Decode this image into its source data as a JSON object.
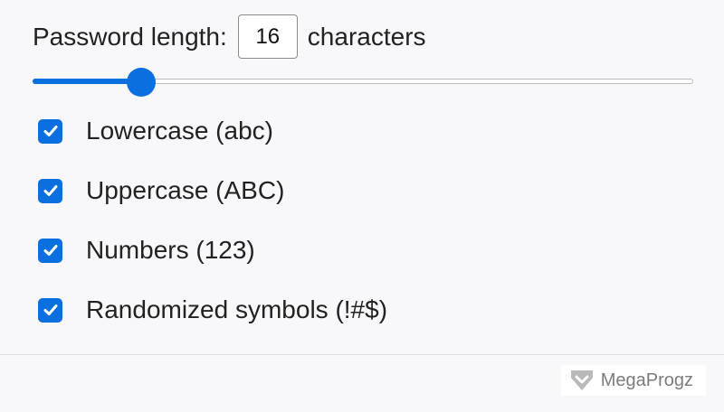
{
  "password_length": {
    "label": "Password length:",
    "value": "16",
    "suffix": "characters"
  },
  "slider": {
    "fill_fraction": 0.165,
    "accent_color": "#0b6fe0"
  },
  "options": [
    {
      "label": "Lowercase (abc)",
      "checked": true
    },
    {
      "label": "Uppercase (ABC)",
      "checked": true
    },
    {
      "label": "Numbers (123)",
      "checked": true
    },
    {
      "label": "Randomized symbols (!#$)",
      "checked": true
    }
  ],
  "watermark": {
    "text": "MegaProgz",
    "icon": "megaprogz-logo-icon"
  }
}
